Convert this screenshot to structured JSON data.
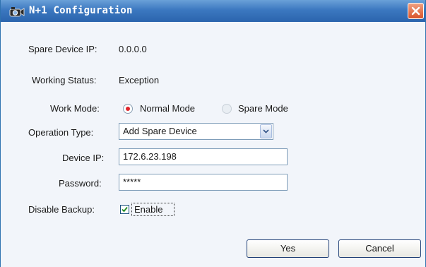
{
  "window": {
    "title": "N+1 Configuration"
  },
  "info": {
    "spare_ip_label": "Spare Device IP:",
    "spare_ip_value": "0.0.0.0",
    "working_status_label": "Working Status:",
    "working_status_value": "Exception"
  },
  "form": {
    "work_mode": {
      "label": "Work Mode:",
      "options": [
        "Normal Mode",
        "Spare Mode"
      ],
      "selected": "Normal Mode"
    },
    "operation_type": {
      "label": "Operation Type:",
      "value": "Add Spare Device"
    },
    "device_ip": {
      "label": "Device IP:",
      "value": "172.6.23.198"
    },
    "password": {
      "label": "Password:",
      "value": "*****"
    },
    "disable_backup": {
      "label": "Disable Backup:",
      "checkbox_label": "Enable",
      "checked": true
    }
  },
  "buttons": {
    "yes": "Yes",
    "cancel": "Cancel"
  },
  "colors": {
    "titlebar": "#3c78c0",
    "close_button": "#d9542c",
    "radio_selected": "#e0242b",
    "checkmark": "#1e8a1e"
  }
}
